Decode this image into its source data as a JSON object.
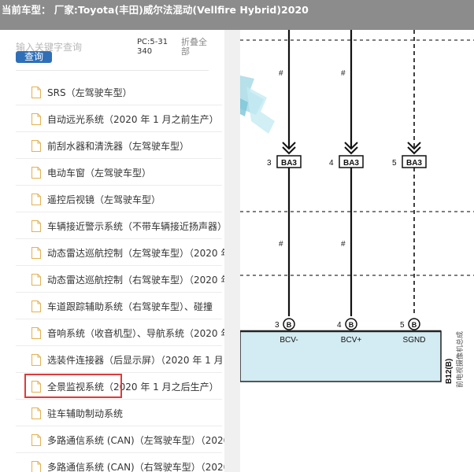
{
  "header": {
    "title": "当前车型：  厂家:Toyota(丰田)威尔法混动(Vellfire Hybrid)2020"
  },
  "sidebar": {
    "search": {
      "placeholder": "输入关键字查询",
      "button_label": "查询"
    },
    "pc_code": "PC:5-31340",
    "collapse_label": "折叠全部",
    "scroll_indicator": "↕",
    "items": [
      {
        "label": "SRS（左驾驶车型）"
      },
      {
        "label": "自动远光系统（2020 年 1 月之前生产）"
      },
      {
        "label": "前刮水器和清洗器（左驾驶车型）"
      },
      {
        "label": "电动车窗（左驾驶车型）"
      },
      {
        "label": "遥控后视镜（左驾驶车型）"
      },
      {
        "label": "车辆接近警示系统（不带车辆接近扬声器）"
      },
      {
        "label": "动态雷达巡航控制（左驾驶车型）（2020 年"
      },
      {
        "label": "动态雷达巡航控制（右驾驶车型）（2020 年"
      },
      {
        "label": "车道跟踪辅助系统（右驾驶车型）、碰撞"
      },
      {
        "label": "音响系统（收音机型）、导航系统（2020 年"
      },
      {
        "label": "选装件连接器（后显示屏）（2020 年 1 月"
      },
      {
        "label": "全景监视系统（2020 年 1 月之后生产）"
      },
      {
        "label": "驻车辅助制动系统"
      },
      {
        "label": "多路通信系统 (CAN)（左驾驶车型）（2020"
      },
      {
        "label": "多路通信系统 (CAN)（右驾驶车型）（2020"
      }
    ]
  },
  "diagram": {
    "wire_marks": [
      "#",
      "#",
      "#",
      "#"
    ],
    "connectors": [
      {
        "pin": "3",
        "name": "BA3"
      },
      {
        "pin": "4",
        "name": "BA3"
      },
      {
        "pin": "5",
        "name": "BA3"
      }
    ],
    "terminals": [
      {
        "pin": "3",
        "marker": "B",
        "signal": "BCV-"
      },
      {
        "pin": "4",
        "marker": "B",
        "signal": "BCV+"
      },
      {
        "pin": "5",
        "marker": "B",
        "signal": "SGND"
      }
    ],
    "component_code": "B12(B)",
    "component_name": "前电视摄像机总成"
  },
  "colors": {
    "header_bg": "#8c8c8c",
    "search_button": "#2f6fb7",
    "highlight_border": "#e0393a",
    "component_fill": "#d3ebf2",
    "wire_color": "#111111"
  }
}
